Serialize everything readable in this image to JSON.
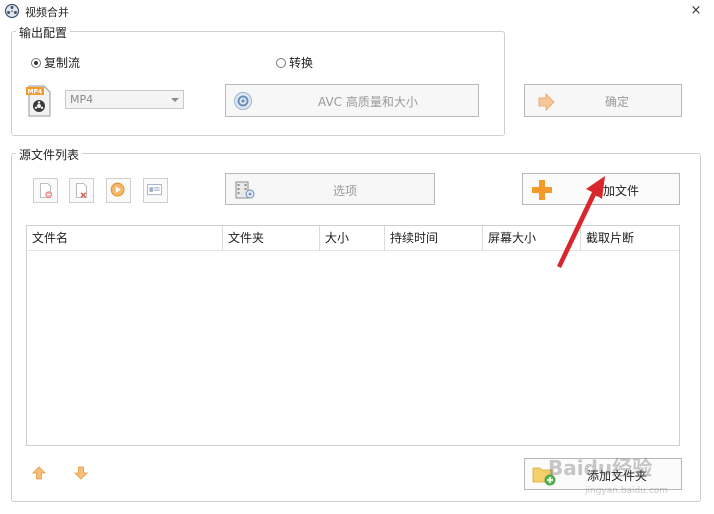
{
  "window": {
    "title": "视频合并",
    "close_glyph": "×",
    "icon": "film-reel-icon"
  },
  "output_config": {
    "legend": "输出配置",
    "radio_copy_stream": "复制流",
    "radio_convert": "转换",
    "selected_radio": "copy_stream",
    "format_value": "MP4",
    "format_icon": "mp4-file-icon",
    "preset_label": "AVC 高质量和大小",
    "confirm_label": "确定"
  },
  "source_files": {
    "legend": "源文件列表",
    "toolbar_icons": [
      "remove-file-icon",
      "clear-list-icon",
      "play-icon",
      "info-icon"
    ],
    "options_label": "选项",
    "add_file_label": "添加文件",
    "add_folder_label": "添加文件夹",
    "columns": [
      "文件名",
      "文件夹",
      "大小",
      "持续时间",
      "屏幕大小",
      "截取片断"
    ],
    "rows": []
  },
  "colors": {
    "accent_orange": "#f39a2a",
    "arrow_red": "#d9252c",
    "border": "#cfcfcf"
  },
  "watermark": {
    "text": "Baidu经验",
    "sub": "jingyan.baidu.com"
  }
}
